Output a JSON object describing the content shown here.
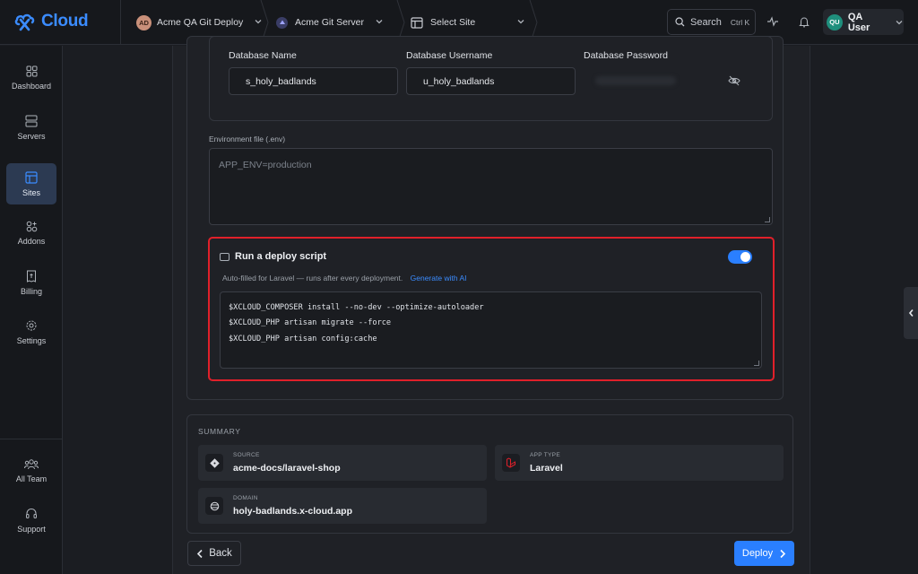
{
  "app": {
    "logo_text": "Cloud",
    "brand_color": "#3b8cff"
  },
  "breadcrumbs": [
    {
      "avatar": "AD",
      "label": "Acme QA Git Deploy"
    },
    {
      "label": "Acme Git Server",
      "icon": "server-icon"
    },
    {
      "label": "Select Site",
      "icon": "site-layout-icon"
    }
  ],
  "header": {
    "search_label": "Search",
    "search_shortcut": "Ctrl K",
    "user_initials": "QU",
    "user_name": "QA User"
  },
  "sidebar": {
    "items": [
      {
        "label": "Dashboard",
        "icon": "dashboard-icon"
      },
      {
        "label": "Servers",
        "icon": "server-icon"
      },
      {
        "label": "Sites",
        "icon": "sites-icon",
        "active": true
      },
      {
        "label": "Addons",
        "icon": "addons-icon"
      },
      {
        "label": "Billing",
        "icon": "billing-icon"
      },
      {
        "label": "Settings",
        "icon": "gear-icon"
      }
    ],
    "bottom_items": [
      {
        "label": "All Team",
        "icon": "team-icon"
      },
      {
        "label": "Support",
        "icon": "headset-icon"
      }
    ]
  },
  "database": {
    "name_label": "Database Name",
    "name_value": "s_holy_badlands",
    "username_label": "Database Username",
    "username_value": "u_holy_badlands",
    "password_label": "Database Password"
  },
  "env": {
    "label": "Environment file (.env)",
    "placeholder": "APP_ENV=production"
  },
  "deploy_script": {
    "title": "Run a deploy script",
    "subtitle": "Auto-filled for Laravel — runs after every deployment.",
    "ai_link": "Generate with AI",
    "enabled": true,
    "lines": [
      "$XCLOUD_COMPOSER install --no-dev --optimize-autoloader",
      "$XCLOUD_PHP artisan migrate --force",
      "$XCLOUD_PHP artisan config:cache"
    ]
  },
  "summary": {
    "title": "SUMMARY",
    "source_caption": "SOURCE",
    "source_value": "acme-docs/laravel-shop",
    "app_type_caption": "APP TYPE",
    "app_type_value": "Laravel",
    "domain_caption": "DOMAIN",
    "domain_value": "holy-badlands.x-cloud.app"
  },
  "footer": {
    "back_label": "Back",
    "deploy_label": "Deploy"
  },
  "colors": {
    "accent": "#2a7fff",
    "highlight_border": "#e0202a",
    "laravel": "#e0202a"
  }
}
